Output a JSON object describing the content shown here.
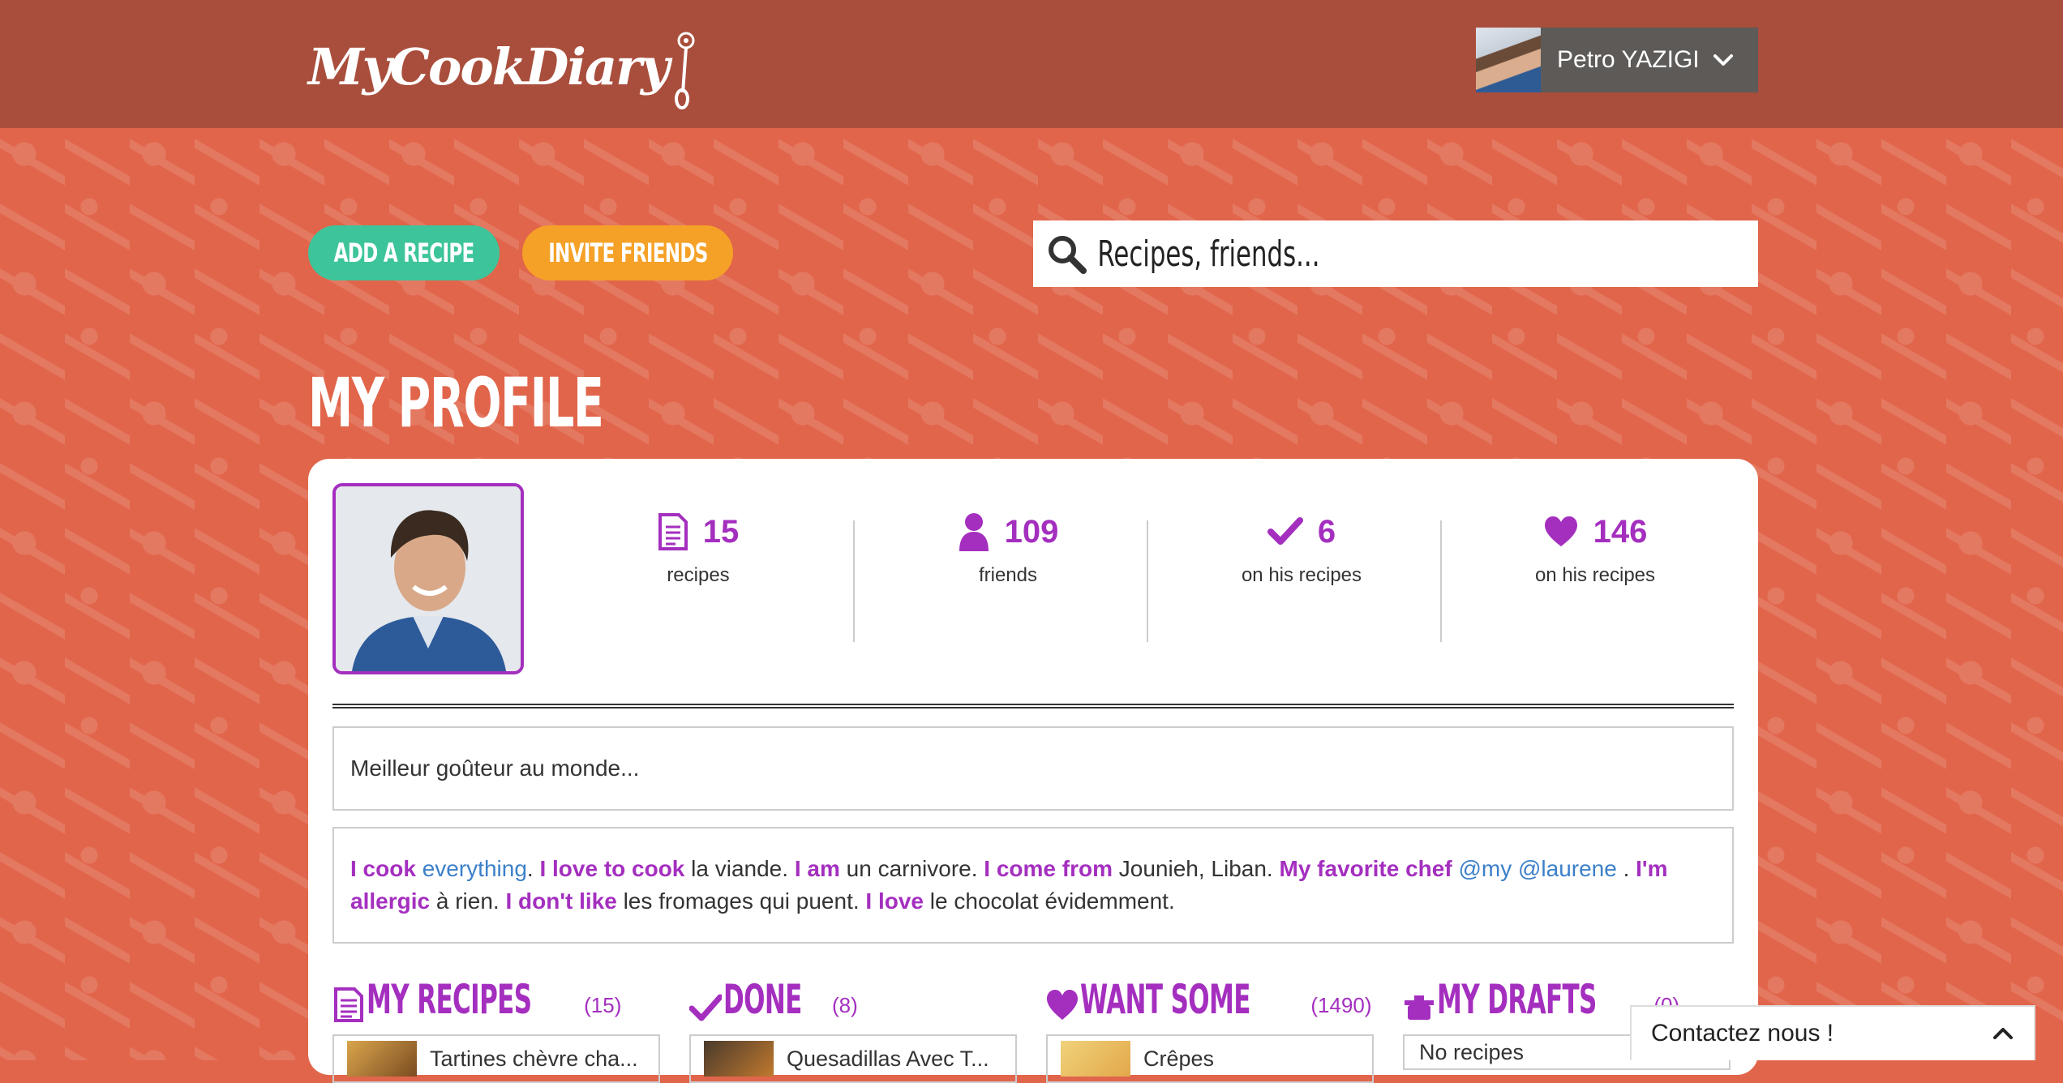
{
  "brand": {
    "name": "MyCookDiary"
  },
  "user": {
    "name": "Petro YAZIGI"
  },
  "actions": {
    "add_recipe": "ADD A RECIPE",
    "invite_friends": "INVITE FRIENDS"
  },
  "search": {
    "placeholder": "Recipes, friends..."
  },
  "page": {
    "title": "MY PROFILE"
  },
  "stats": [
    {
      "icon": "document-icon",
      "value": "15",
      "label": "recipes"
    },
    {
      "icon": "person-icon",
      "value": "109",
      "label": "friends"
    },
    {
      "icon": "check-icon",
      "value": "6",
      "label": "on his recipes"
    },
    {
      "icon": "heart-icon",
      "value": "146",
      "label": "on his recipes"
    }
  ],
  "bio": "Meilleur goûteur au monde...",
  "preferences": {
    "cook_k": "I cook",
    "cook_v": "everything",
    "love_cook_k": "I love to cook",
    "love_cook_v": "la viande.",
    "am_k": "I am",
    "am_v": "un carnivore.",
    "from_k": "I come from",
    "from_v": "Jounieh, Liban.",
    "chef_k": "My favorite chef",
    "chef_v": "@my @laurene",
    "allergic_k": "I'm allergic",
    "allergic_v": "à rien.",
    "dislike_k": "I don't like",
    "dislike_v": "les fromages qui puent.",
    "love_k": "I love",
    "love_v": "le chocolat évidemment."
  },
  "sections": [
    {
      "title": "MY RECIPES",
      "count": "(15)",
      "icon": "document-icon",
      "first_item": "Tartines chèvre cha..."
    },
    {
      "title": "DONE",
      "count": "(8)",
      "icon": "check-icon",
      "first_item": "Quesadillas Avec T..."
    },
    {
      "title": "WANT SOME",
      "count": "(1490)",
      "icon": "heart-icon",
      "first_item": "Crêpes"
    },
    {
      "title": "MY DRAFTS",
      "count": "(0)",
      "icon": "pot-icon",
      "first_item": "No recipes"
    }
  ],
  "contact": {
    "label": "Contactez nous !"
  },
  "colors": {
    "accent": "#a42fbf",
    "background": "#e1654a",
    "topbar": "#a94e3c",
    "add_button": "#3dc49b",
    "invite_button": "#f5a127",
    "link": "#3c80c9"
  }
}
